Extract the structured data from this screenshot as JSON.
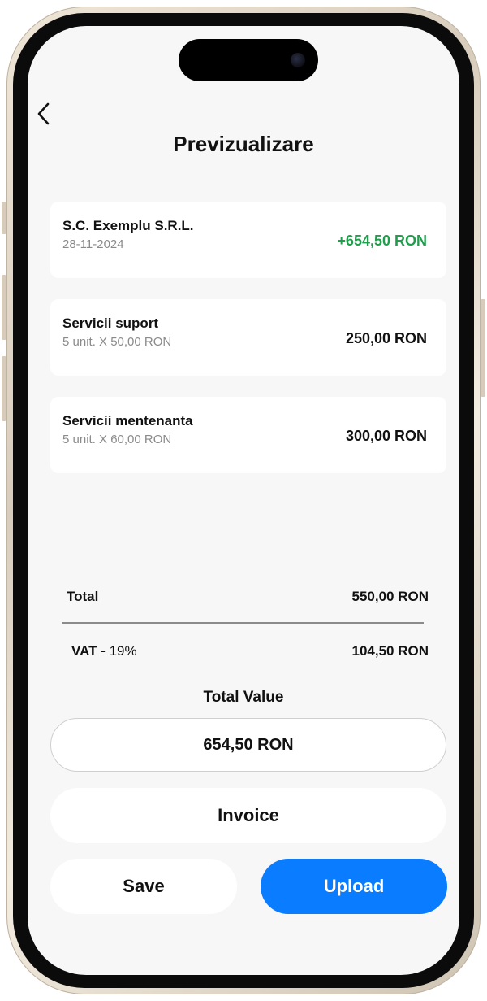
{
  "header": {
    "title": "Previzualizare"
  },
  "client": {
    "name": "S.C. Exemplu S.R.L.",
    "date": "28-11-2024",
    "amount": "+654,50 RON"
  },
  "items": [
    {
      "name": "Servicii suport",
      "detail": "5 unit. X 50,00 RON",
      "amount": "250,00 RON"
    },
    {
      "name": "Servicii mentenanta",
      "detail": "5 unit. X 60,00 RON",
      "amount": "300,00 RON"
    }
  ],
  "summary": {
    "total_label": "Total",
    "total_value": "550,00 RON",
    "vat_label": "VAT",
    "vat_rate": " - 19%",
    "vat_value": "104,50 RON",
    "total_value_label": "Total Value",
    "total_value_amount": "654,50 RON"
  },
  "actions": {
    "invoice_label": "Invoice",
    "save_label": "Save",
    "upload_label": "Upload"
  },
  "colors": {
    "accent": "#0a7cff",
    "positive": "#1f9e4b",
    "background": "#f7f7f7",
    "frame": "#d8cdbd"
  },
  "icons": {
    "back": "chevron-left-icon",
    "camera": "front-camera-icon"
  }
}
